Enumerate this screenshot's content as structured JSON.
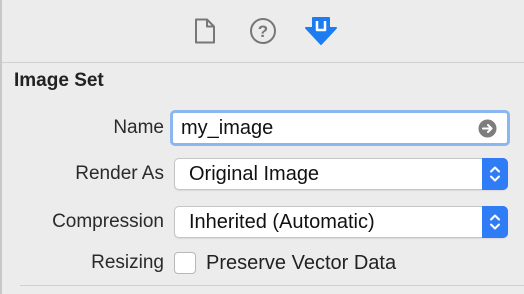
{
  "toolbar": {
    "tabs": [
      {
        "icon": "file-icon",
        "active": false
      },
      {
        "icon": "help-circle-icon",
        "active": false
      },
      {
        "icon": "attributes-inspector-icon",
        "active": true
      }
    ],
    "accent_color": "#1e7cf2"
  },
  "section": {
    "title": "Image Set"
  },
  "fields": {
    "name": {
      "label": "Name",
      "value": "my_image"
    },
    "render_as": {
      "label": "Render As",
      "value": "Original Image"
    },
    "compression": {
      "label": "Compression",
      "value": "Inherited (Automatic)"
    },
    "resizing": {
      "label": "Resizing",
      "checkbox_label": "Preserve Vector Data",
      "checked": false
    }
  }
}
